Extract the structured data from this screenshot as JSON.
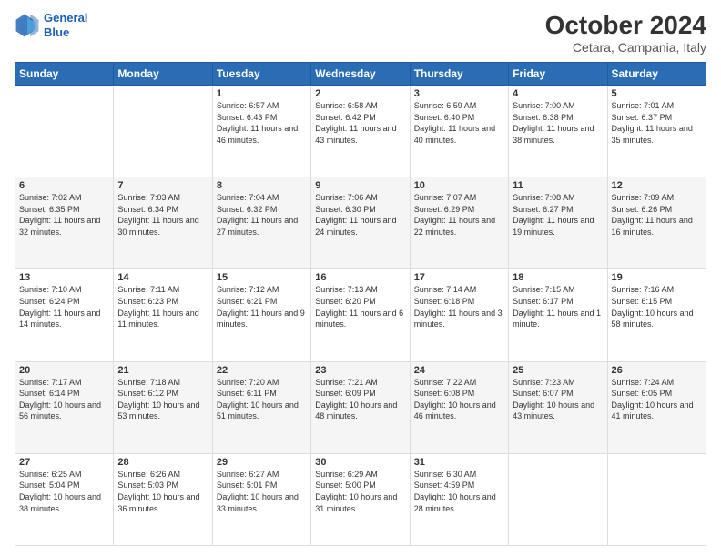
{
  "header": {
    "logo_line1": "General",
    "logo_line2": "Blue",
    "title": "October 2024",
    "subtitle": "Cetara, Campania, Italy"
  },
  "days_of_week": [
    "Sunday",
    "Monday",
    "Tuesday",
    "Wednesday",
    "Thursday",
    "Friday",
    "Saturday"
  ],
  "weeks": [
    [
      {
        "day": "",
        "sunrise": "",
        "sunset": "",
        "daylight": ""
      },
      {
        "day": "",
        "sunrise": "",
        "sunset": "",
        "daylight": ""
      },
      {
        "day": "1",
        "sunrise": "Sunrise: 6:57 AM",
        "sunset": "Sunset: 6:43 PM",
        "daylight": "Daylight: 11 hours and 46 minutes."
      },
      {
        "day": "2",
        "sunrise": "Sunrise: 6:58 AM",
        "sunset": "Sunset: 6:42 PM",
        "daylight": "Daylight: 11 hours and 43 minutes."
      },
      {
        "day": "3",
        "sunrise": "Sunrise: 6:59 AM",
        "sunset": "Sunset: 6:40 PM",
        "daylight": "Daylight: 11 hours and 40 minutes."
      },
      {
        "day": "4",
        "sunrise": "Sunrise: 7:00 AM",
        "sunset": "Sunset: 6:38 PM",
        "daylight": "Daylight: 11 hours and 38 minutes."
      },
      {
        "day": "5",
        "sunrise": "Sunrise: 7:01 AM",
        "sunset": "Sunset: 6:37 PM",
        "daylight": "Daylight: 11 hours and 35 minutes."
      }
    ],
    [
      {
        "day": "6",
        "sunrise": "Sunrise: 7:02 AM",
        "sunset": "Sunset: 6:35 PM",
        "daylight": "Daylight: 11 hours and 32 minutes."
      },
      {
        "day": "7",
        "sunrise": "Sunrise: 7:03 AM",
        "sunset": "Sunset: 6:34 PM",
        "daylight": "Daylight: 11 hours and 30 minutes."
      },
      {
        "day": "8",
        "sunrise": "Sunrise: 7:04 AM",
        "sunset": "Sunset: 6:32 PM",
        "daylight": "Daylight: 11 hours and 27 minutes."
      },
      {
        "day": "9",
        "sunrise": "Sunrise: 7:06 AM",
        "sunset": "Sunset: 6:30 PM",
        "daylight": "Daylight: 11 hours and 24 minutes."
      },
      {
        "day": "10",
        "sunrise": "Sunrise: 7:07 AM",
        "sunset": "Sunset: 6:29 PM",
        "daylight": "Daylight: 11 hours and 22 minutes."
      },
      {
        "day": "11",
        "sunrise": "Sunrise: 7:08 AM",
        "sunset": "Sunset: 6:27 PM",
        "daylight": "Daylight: 11 hours and 19 minutes."
      },
      {
        "day": "12",
        "sunrise": "Sunrise: 7:09 AM",
        "sunset": "Sunset: 6:26 PM",
        "daylight": "Daylight: 11 hours and 16 minutes."
      }
    ],
    [
      {
        "day": "13",
        "sunrise": "Sunrise: 7:10 AM",
        "sunset": "Sunset: 6:24 PM",
        "daylight": "Daylight: 11 hours and 14 minutes."
      },
      {
        "day": "14",
        "sunrise": "Sunrise: 7:11 AM",
        "sunset": "Sunset: 6:23 PM",
        "daylight": "Daylight: 11 hours and 11 minutes."
      },
      {
        "day": "15",
        "sunrise": "Sunrise: 7:12 AM",
        "sunset": "Sunset: 6:21 PM",
        "daylight": "Daylight: 11 hours and 9 minutes."
      },
      {
        "day": "16",
        "sunrise": "Sunrise: 7:13 AM",
        "sunset": "Sunset: 6:20 PM",
        "daylight": "Daylight: 11 hours and 6 minutes."
      },
      {
        "day": "17",
        "sunrise": "Sunrise: 7:14 AM",
        "sunset": "Sunset: 6:18 PM",
        "daylight": "Daylight: 11 hours and 3 minutes."
      },
      {
        "day": "18",
        "sunrise": "Sunrise: 7:15 AM",
        "sunset": "Sunset: 6:17 PM",
        "daylight": "Daylight: 11 hours and 1 minute."
      },
      {
        "day": "19",
        "sunrise": "Sunrise: 7:16 AM",
        "sunset": "Sunset: 6:15 PM",
        "daylight": "Daylight: 10 hours and 58 minutes."
      }
    ],
    [
      {
        "day": "20",
        "sunrise": "Sunrise: 7:17 AM",
        "sunset": "Sunset: 6:14 PM",
        "daylight": "Daylight: 10 hours and 56 minutes."
      },
      {
        "day": "21",
        "sunrise": "Sunrise: 7:18 AM",
        "sunset": "Sunset: 6:12 PM",
        "daylight": "Daylight: 10 hours and 53 minutes."
      },
      {
        "day": "22",
        "sunrise": "Sunrise: 7:20 AM",
        "sunset": "Sunset: 6:11 PM",
        "daylight": "Daylight: 10 hours and 51 minutes."
      },
      {
        "day": "23",
        "sunrise": "Sunrise: 7:21 AM",
        "sunset": "Sunset: 6:09 PM",
        "daylight": "Daylight: 10 hours and 48 minutes."
      },
      {
        "day": "24",
        "sunrise": "Sunrise: 7:22 AM",
        "sunset": "Sunset: 6:08 PM",
        "daylight": "Daylight: 10 hours and 46 minutes."
      },
      {
        "day": "25",
        "sunrise": "Sunrise: 7:23 AM",
        "sunset": "Sunset: 6:07 PM",
        "daylight": "Daylight: 10 hours and 43 minutes."
      },
      {
        "day": "26",
        "sunrise": "Sunrise: 7:24 AM",
        "sunset": "Sunset: 6:05 PM",
        "daylight": "Daylight: 10 hours and 41 minutes."
      }
    ],
    [
      {
        "day": "27",
        "sunrise": "Sunrise: 6:25 AM",
        "sunset": "Sunset: 5:04 PM",
        "daylight": "Daylight: 10 hours and 38 minutes."
      },
      {
        "day": "28",
        "sunrise": "Sunrise: 6:26 AM",
        "sunset": "Sunset: 5:03 PM",
        "daylight": "Daylight: 10 hours and 36 minutes."
      },
      {
        "day": "29",
        "sunrise": "Sunrise: 6:27 AM",
        "sunset": "Sunset: 5:01 PM",
        "daylight": "Daylight: 10 hours and 33 minutes."
      },
      {
        "day": "30",
        "sunrise": "Sunrise: 6:29 AM",
        "sunset": "Sunset: 5:00 PM",
        "daylight": "Daylight: 10 hours and 31 minutes."
      },
      {
        "day": "31",
        "sunrise": "Sunrise: 6:30 AM",
        "sunset": "Sunset: 4:59 PM",
        "daylight": "Daylight: 10 hours and 28 minutes."
      },
      {
        "day": "",
        "sunrise": "",
        "sunset": "",
        "daylight": ""
      },
      {
        "day": "",
        "sunrise": "",
        "sunset": "",
        "daylight": ""
      }
    ]
  ]
}
